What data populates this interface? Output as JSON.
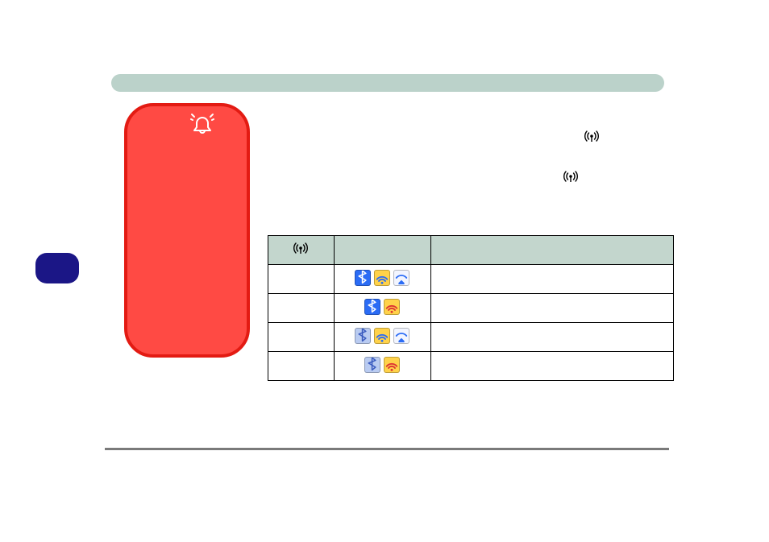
{
  "table": {
    "headers": [
      "",
      "",
      ""
    ],
    "rows": [
      {
        "col1": "",
        "icons": [
          "bt-on",
          "wifi-on",
          "3g-on"
        ],
        "col3": ""
      },
      {
        "col1": "",
        "icons": [
          "bt-on",
          "wifi-off"
        ],
        "col3": ""
      },
      {
        "col1": "",
        "icons": [
          "bt-off",
          "wifi-on",
          "3g-on"
        ],
        "col3": ""
      },
      {
        "col1": "",
        "icons": [
          "bt-off",
          "wifi-off"
        ],
        "col3": ""
      }
    ]
  },
  "icons": {
    "antenna": "antenna-icon",
    "bell": "bell-icon",
    "bt-on": "bluetooth-on-icon",
    "bt-off": "bluetooth-off-icon",
    "wifi-on": "wifi-on-icon",
    "wifi-off": "wifi-off-icon",
    "3g-on": "3g-on-icon"
  },
  "colors": {
    "band": "#BBD2CA",
    "red_panel": "#FF4A44",
    "red_border": "#E31B13",
    "indigo_pill": "#1B1686",
    "table_head": "#C3D6CD",
    "hr": "#7A7A7A"
  }
}
